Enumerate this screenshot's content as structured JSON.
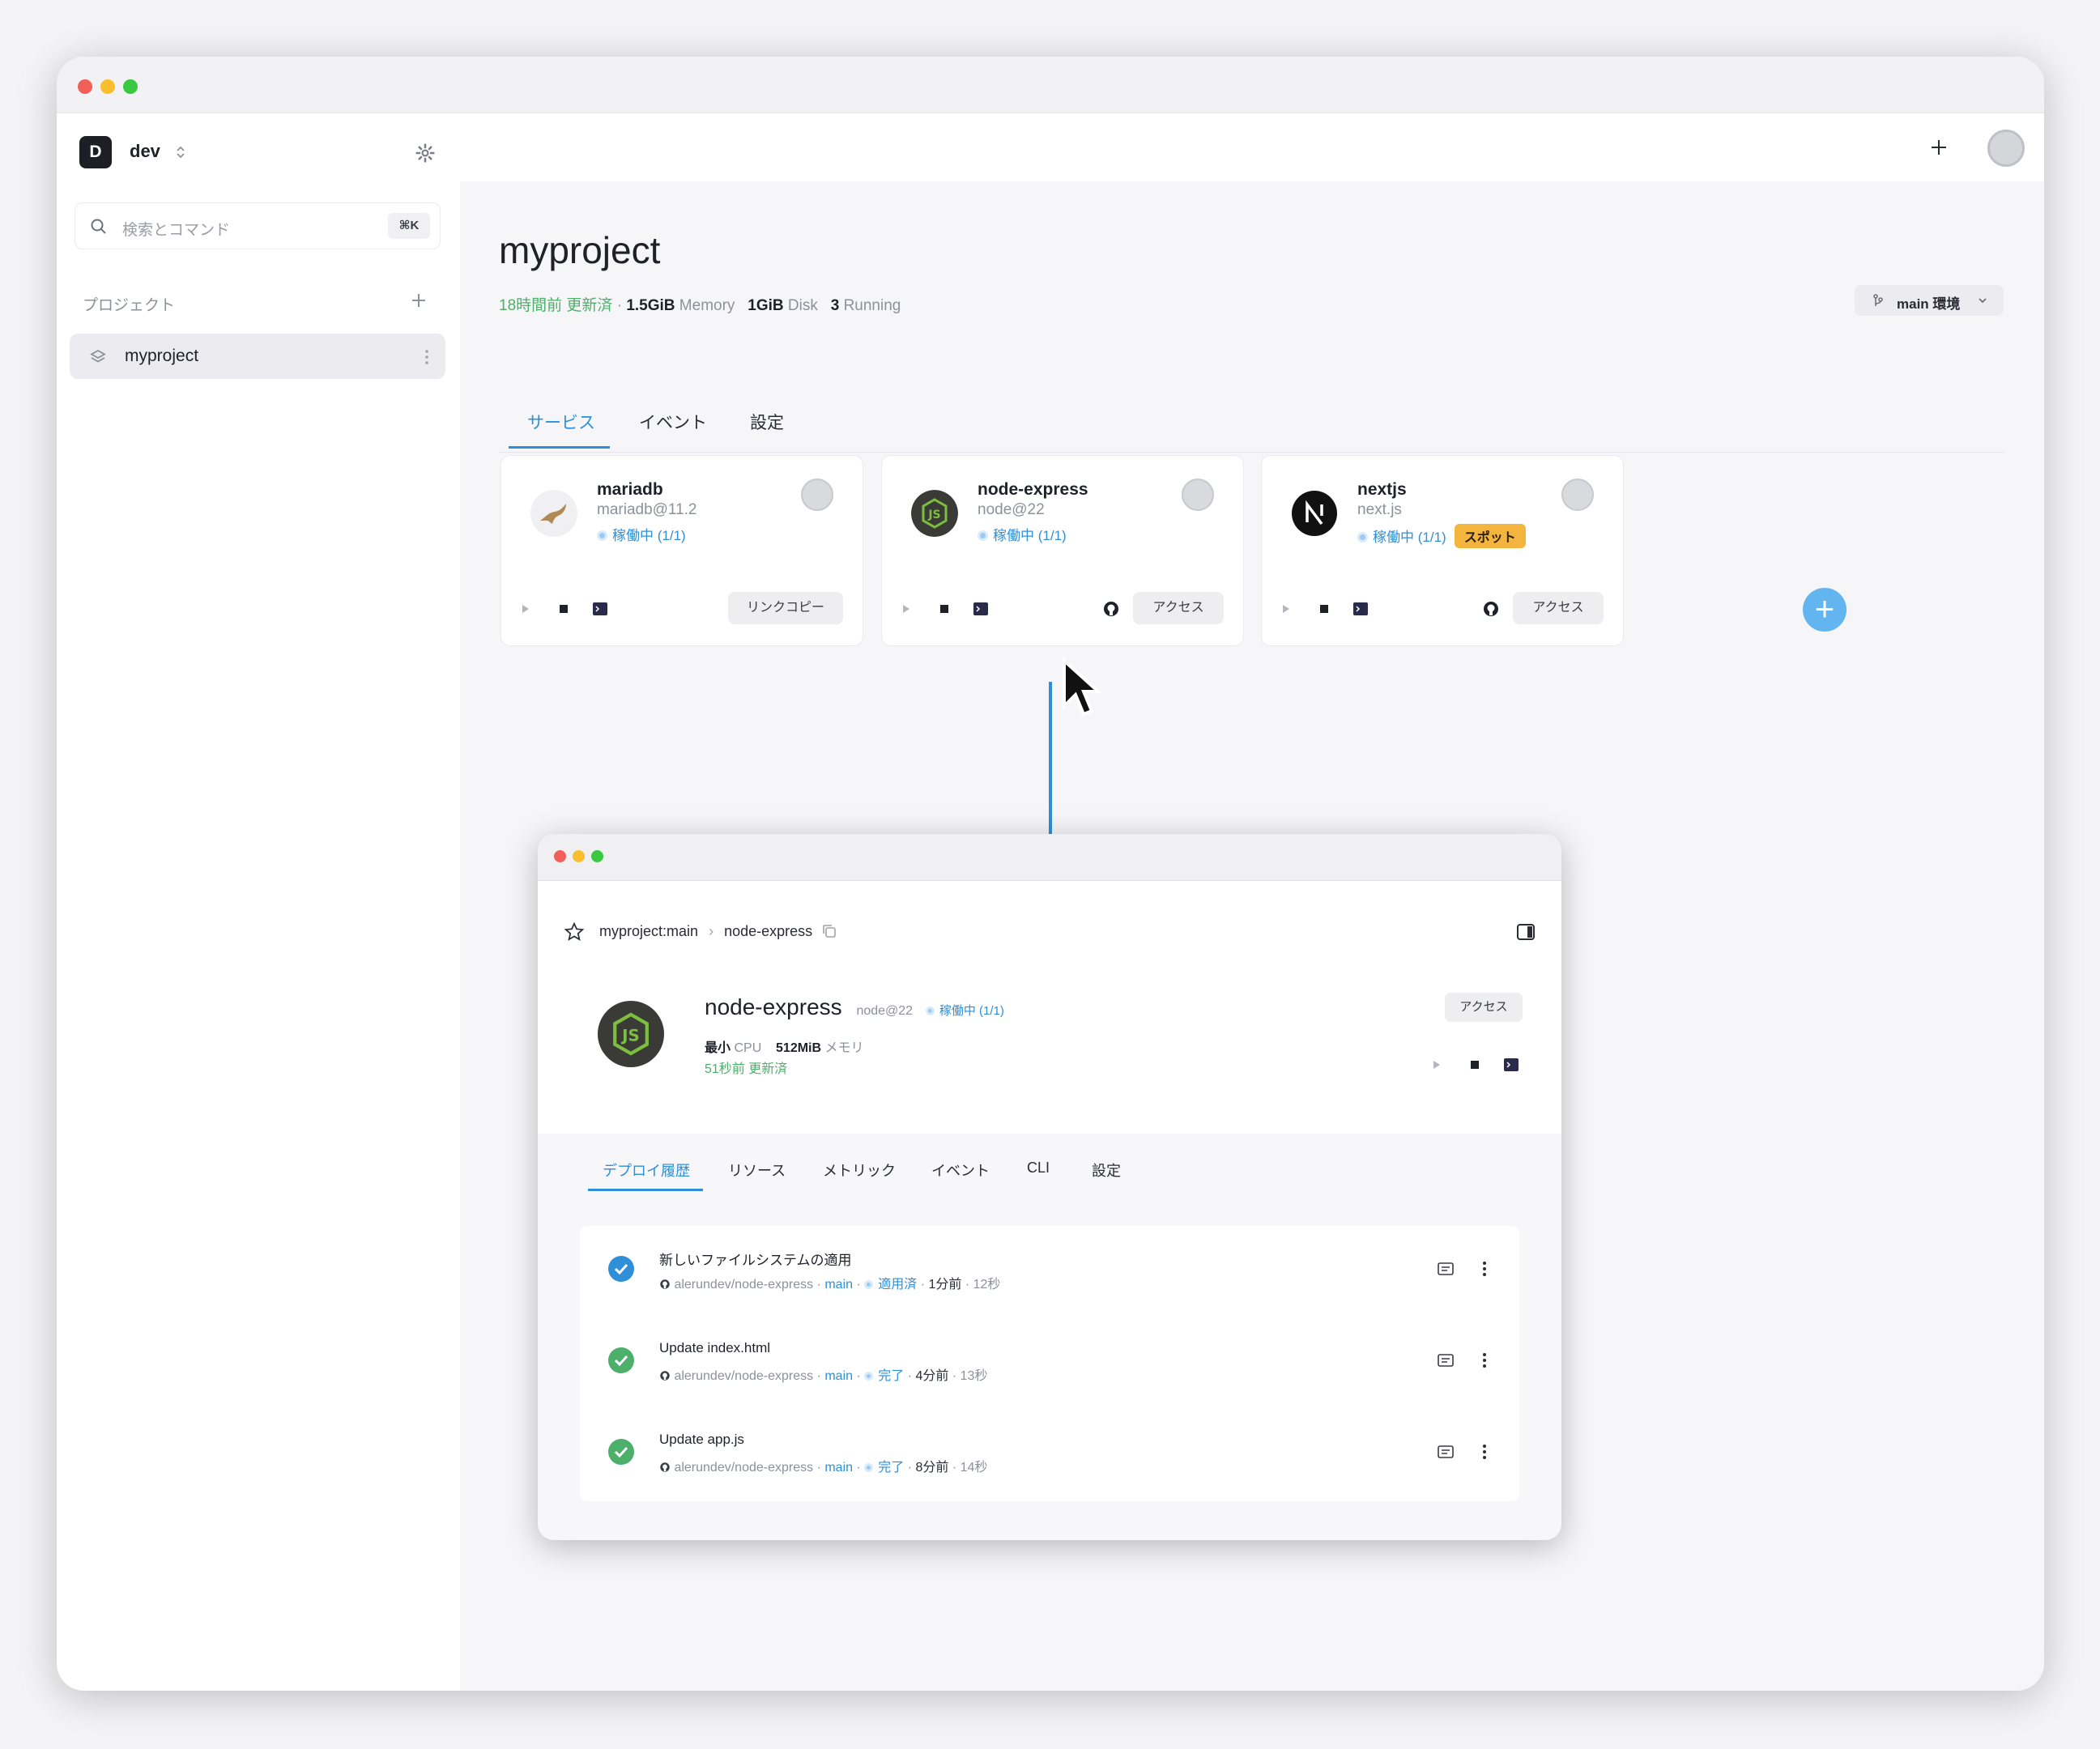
{
  "sidebar": {
    "workspace_initial": "D",
    "workspace_name": "dev",
    "search_placeholder": "検索とコマンド",
    "search_shortcut": "⌘K",
    "projects_label": "プロジェクト",
    "projects": [
      {
        "label": "myproject"
      }
    ]
  },
  "project": {
    "title": "myproject",
    "updated": "18時間前 更新済",
    "memory_value": "1.5GiB",
    "memory_label": "Memory",
    "disk_value": "1GiB",
    "disk_label": "Disk",
    "running_value": "3",
    "running_label": "Running",
    "branch_label": "main 環境"
  },
  "tabs": [
    {
      "label": "サービス",
      "active": true
    },
    {
      "label": "イベント",
      "active": false
    },
    {
      "label": "設定",
      "active": false
    }
  ],
  "services": [
    {
      "name": "mariadb",
      "version": "mariadb@11.2",
      "status": "稼働中",
      "count": "(1/1)",
      "button": "リンクコピー"
    },
    {
      "name": "node-express",
      "version": "node@22",
      "status": "稼働中",
      "count": "(1/1)",
      "button": "アクセス"
    },
    {
      "name": "nextjs",
      "version": "next.js",
      "status": "稼働中",
      "count": "(1/1)",
      "badge": "スポット",
      "button": "アクセス"
    }
  ],
  "detail": {
    "breadcrumb_project": "myproject:main",
    "breadcrumb_service": "node-express",
    "title": "node-express",
    "version": "node@22",
    "status": "稼働中",
    "count": "(1/1)",
    "access_button": "アクセス",
    "cpu_value": "最小",
    "cpu_label": "CPU",
    "memory_value": "512MiB",
    "memory_label": "メモリ",
    "updated": "51秒前 更新済",
    "tabs": [
      {
        "label": "デプロイ履歴",
        "active": true
      },
      {
        "label": "リソース",
        "active": false
      },
      {
        "label": "メトリック",
        "active": false
      },
      {
        "label": "イベント",
        "active": false
      },
      {
        "label": "CLI",
        "active": false
      },
      {
        "label": "設定",
        "active": false
      }
    ],
    "deploys": [
      {
        "message": "新しいファイルシステムの適用",
        "repo": "alerundev/node-express",
        "branch": "main",
        "state": "適用済",
        "ago": "1分前",
        "duration": "12秒",
        "state_color": "#2f8fd8"
      },
      {
        "message": "Update index.html",
        "repo": "alerundev/node-express",
        "branch": "main",
        "state": "完了",
        "ago": "4分前",
        "duration": "13秒",
        "state_color": "#4caf6a"
      },
      {
        "message": "Update app.js",
        "repo": "alerundev/node-express",
        "branch": "main",
        "state": "完了",
        "ago": "8分前",
        "duration": "14秒",
        "state_color": "#4caf6a"
      }
    ]
  },
  "colors": {
    "accent": "#2f8fd8",
    "success": "#4caf6a",
    "spot": "#f4b53f"
  }
}
